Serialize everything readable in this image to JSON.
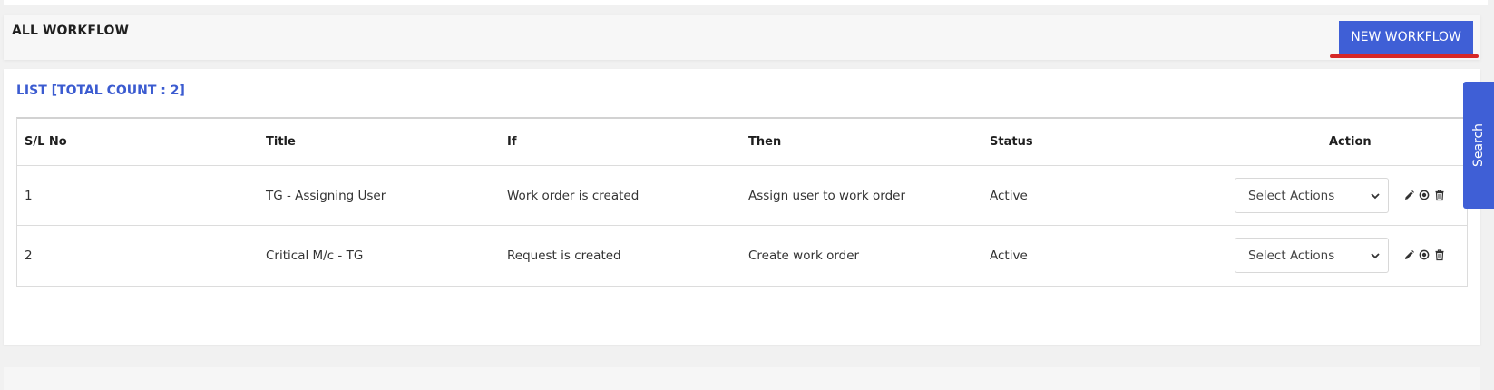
{
  "header": {
    "title": "ALL WORKFLOW",
    "new_button": "NEW WORKFLOW"
  },
  "list": {
    "title": "LIST [TOTAL COUNT : 2]",
    "columns": [
      "S/L No",
      "Title",
      "If",
      "Then",
      "Status",
      "Action"
    ],
    "rows": [
      {
        "sl": "1",
        "title": "TG - Assigning User",
        "if": "Work order is created",
        "then": "Assign user to work order",
        "status": "Active",
        "action_select": "Select Actions"
      },
      {
        "sl": "2",
        "title": "Critical M/c - TG",
        "if": "Request is created",
        "then": "Create work order",
        "status": "Active",
        "action_select": "Select Actions"
      }
    ]
  },
  "search_tab": {
    "label": "Search"
  },
  "icons": {
    "edit": "pencil-icon",
    "toggle": "radio-circle-icon",
    "delete": "trash-icon"
  },
  "colors": {
    "accent": "#3f5fd6",
    "list_title": "#3b5bd0",
    "underline": "#d62828"
  }
}
